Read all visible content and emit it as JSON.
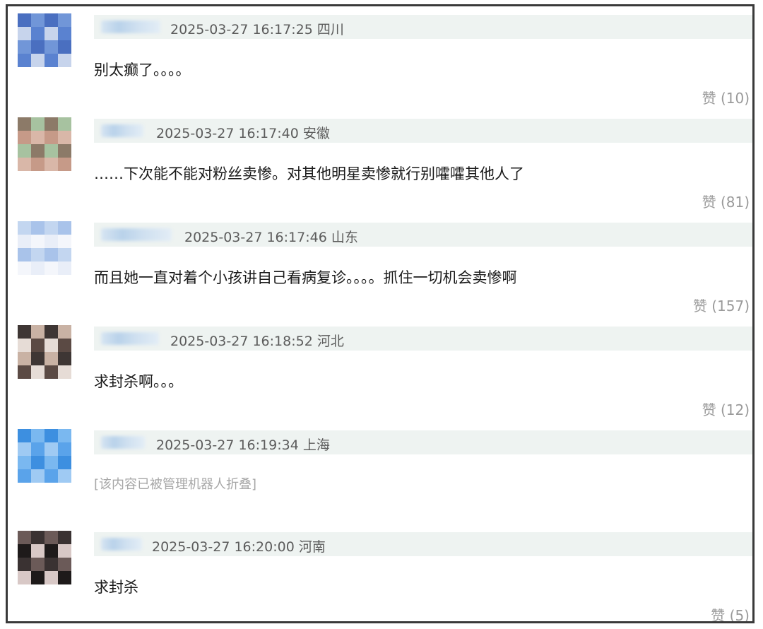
{
  "comments": [
    {
      "username": "",
      "time": "2025-03-27 16:17:25",
      "location": "四川",
      "text": "别太癫了。。。。",
      "like_label": "赞",
      "like_count": "(10)",
      "avatar_colors": [
        "#4a6fc0",
        "#5a82d0",
        "#7196d8",
        "#c7d4ec"
      ]
    },
    {
      "username": "",
      "time": "2025-03-27 16:17:40",
      "location": "安徽",
      "text": "……下次能不能对粉丝卖惨。对其他明星卖惨就行别嚯嚯其他人了",
      "like_label": "赞",
      "like_count": "(81)",
      "avatar_colors": [
        "#c69a88",
        "#8c7a68",
        "#d9b7a8",
        "#a7c2a0"
      ]
    },
    {
      "username": "",
      "time": "2025-03-27 16:17:46",
      "location": "山东",
      "text": "而且她一直对着个小孩讲自己看病复诊。。。。抓住一切机会卖惨啊",
      "like_label": "赞",
      "like_count": "(157)",
      "avatar_colors": [
        "#a9c3ea",
        "#e9eef8",
        "#c3d6f0",
        "#f4f6fb"
      ]
    },
    {
      "username": "",
      "time": "2025-03-27 16:18:52",
      "location": "河北",
      "text": "求封杀啊。。。",
      "like_label": "赞",
      "like_count": "(12)",
      "avatar_colors": [
        "#5b4a44",
        "#c9b2a4",
        "#e6dcd6",
        "#3e3634"
      ]
    },
    {
      "username": "",
      "time": "2025-03-27 16:19:34",
      "location": "上海",
      "text": "[该内容已被管理机器人折叠]",
      "folded": true,
      "like_label": "",
      "like_count": "",
      "avatar_colors": [
        "#3d8fe0",
        "#5aa3ea",
        "#7ab8f0",
        "#9fcaf3"
      ]
    },
    {
      "username": "",
      "time": "2025-03-27 16:20:00",
      "location": "河南",
      "text": "求封杀",
      "like_label": "赞",
      "like_count": "(5)",
      "avatar_colors": [
        "#1e1a1a",
        "#6b5a58",
        "#d8c8c6",
        "#3a3232"
      ]
    }
  ]
}
